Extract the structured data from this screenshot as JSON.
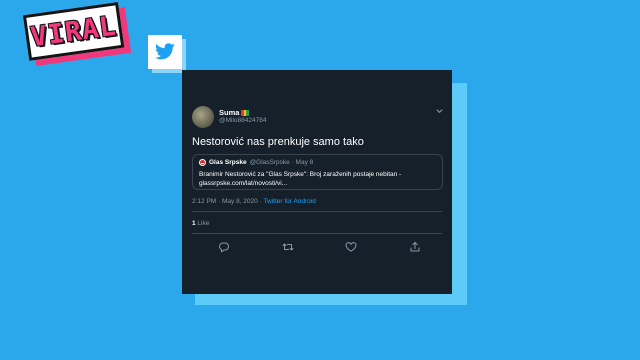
{
  "badge": {
    "text": "VIRAL"
  },
  "logo": {
    "icon": "twitter-bird-icon"
  },
  "tweet": {
    "author_name": "Suma",
    "author_handle": "@Milo88424784",
    "text": "Nestorović nas prenkuje samo tako",
    "quote": {
      "source_name": "Glas Srpske",
      "source_meta": "@GlasSrpske · May 8",
      "body": "Branimir Nestorović za \"Glas Srpske\": Broj zaraženih postaje nebitan - glassrpske.com/lat/novosti/vi..."
    },
    "timestamp": "2:12 PM · May 8, 2020 · ",
    "source_app": "Twitter for Android",
    "like_count": "1",
    "like_label": " Like",
    "actions": [
      "reply-icon",
      "retweet-icon",
      "like-icon",
      "share-icon"
    ]
  },
  "colors": {
    "background": "#2ba7ec",
    "card": "#15202b",
    "accent": "#1da1f2",
    "badge_pink": "#f0387d"
  }
}
